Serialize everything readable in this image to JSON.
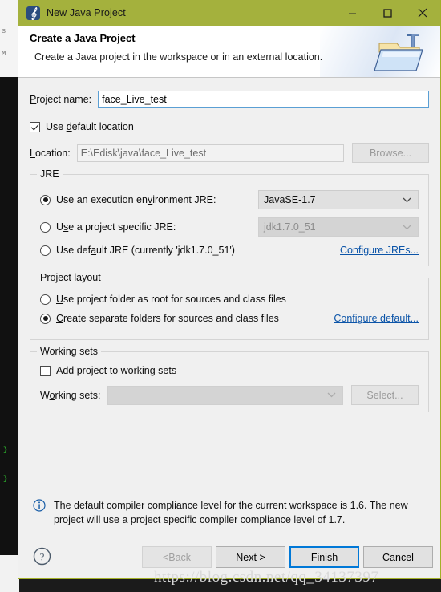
{
  "window": {
    "title": "New Java Project",
    "icon": "java-project-icon",
    "titlebar_color": "#a4b13d",
    "controls": {
      "minimize": "minimize-icon",
      "maximize": "maximize-icon",
      "close": "close-icon"
    }
  },
  "header": {
    "title": "Create a Java Project",
    "description": "Create a Java project in the workspace or in an external location.",
    "icon": "java-folder-wizard-icon"
  },
  "form": {
    "project_name": {
      "label": "Project name:",
      "label_mnemonic": "P",
      "value": "face_Live_test",
      "placeholder": ""
    },
    "use_default_location": {
      "label": "Use default location",
      "label_mnemonic": "d",
      "checked": true
    },
    "location": {
      "label": "Location:",
      "label_mnemonic": "L",
      "value": "E:\\Edisk\\java\\face_Live_test",
      "enabled": false
    },
    "browse_button": {
      "label": "Browse...",
      "enabled": false
    }
  },
  "jre_group": {
    "legend": "JRE",
    "options": [
      {
        "label": "Use an execution environment JRE:",
        "selected": true,
        "combo_value": "JavaSE-1.7",
        "combo_enabled": true
      },
      {
        "label": "Use a project specific JRE:",
        "selected": false,
        "combo_value": "jdk1.7.0_51",
        "combo_enabled": false
      },
      {
        "label": "Use default JRE (currently 'jdk1.7.0_51')",
        "selected": false
      }
    ],
    "link": "Configure JREs..."
  },
  "project_layout_group": {
    "legend": "Project layout",
    "options": [
      {
        "label": "Use project folder as root for sources and class files",
        "selected": false
      },
      {
        "label": "Create separate folders for sources and class files",
        "selected": true
      }
    ],
    "link": "Configure default..."
  },
  "working_sets_group": {
    "legend": "Working sets",
    "checkbox": {
      "label": "Add project to working sets",
      "checked": false
    },
    "combo_label": "Working sets:",
    "combo_value": "",
    "combo_enabled": false,
    "select_button": {
      "label": "Select...",
      "enabled": false
    }
  },
  "info": {
    "icon": "info-icon",
    "text": "The default compiler compliance level for the current workspace is 1.6. The new project will use a project specific compiler compliance level of 1.7."
  },
  "buttons": {
    "help": "help-icon",
    "back": {
      "label": "< Back",
      "enabled": false
    },
    "next": {
      "label": "Next >",
      "enabled": true
    },
    "finish": {
      "label": "Finish",
      "enabled": true,
      "focused": true,
      "focus_color": "#0078d7"
    },
    "cancel": {
      "label": "Cancel",
      "enabled": true
    }
  },
  "watermark": "https://blog.csdn.net/qq_34137397",
  "backdrop": {
    "code_fragments": [
      "}",
      "\"\"",
      "M",
      "s"
    ]
  }
}
